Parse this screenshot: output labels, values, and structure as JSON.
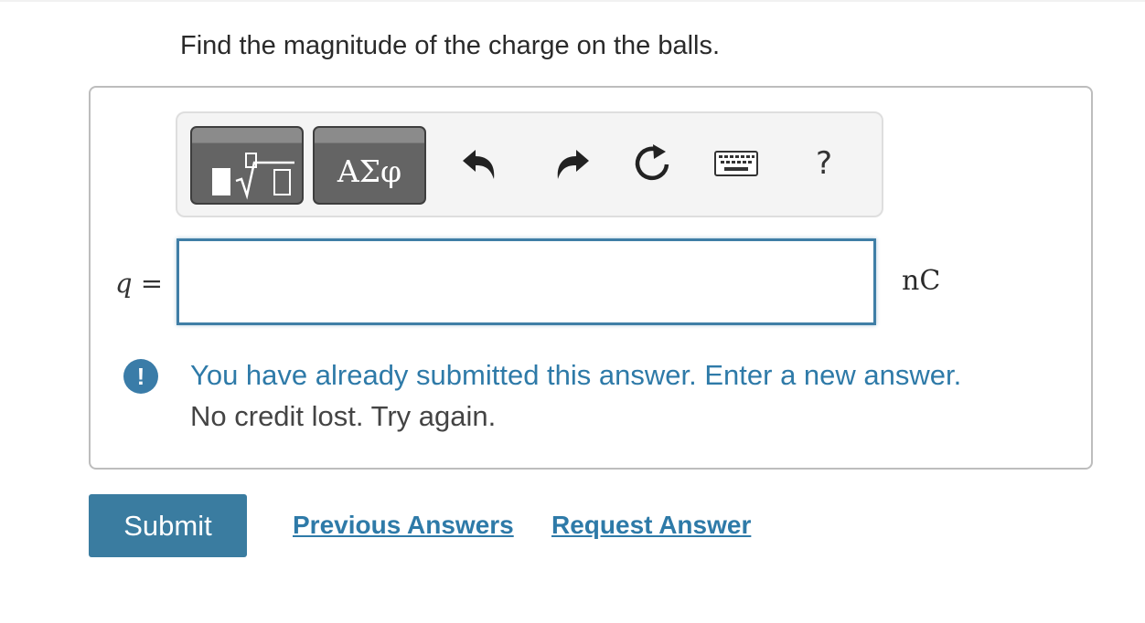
{
  "question": {
    "text": "Find the magnitude of the charge on the balls."
  },
  "toolbar": {
    "templates_icon": "templates-root-icon",
    "greek_label": "ΑΣφ",
    "undo_icon": "undo-icon",
    "redo_icon": "redo-icon",
    "reset_icon": "reset-icon",
    "keyboard_icon": "keyboard-icon",
    "help_label": "?"
  },
  "answer": {
    "variable": "q",
    "equals": "=",
    "value": "",
    "unit": "nC"
  },
  "feedback": {
    "icon": "!",
    "message": "You have already submitted this answer. Enter a new answer.",
    "detail": "No credit lost. Try again.",
    "color": "#2e7aa8"
  },
  "actions": {
    "submit_label": "Submit",
    "previous_answers_label": "Previous Answers",
    "request_answer_label": "Request Answer"
  },
  "colors": {
    "accent": "#3a7ca0",
    "input_border": "#3f7ea6"
  }
}
